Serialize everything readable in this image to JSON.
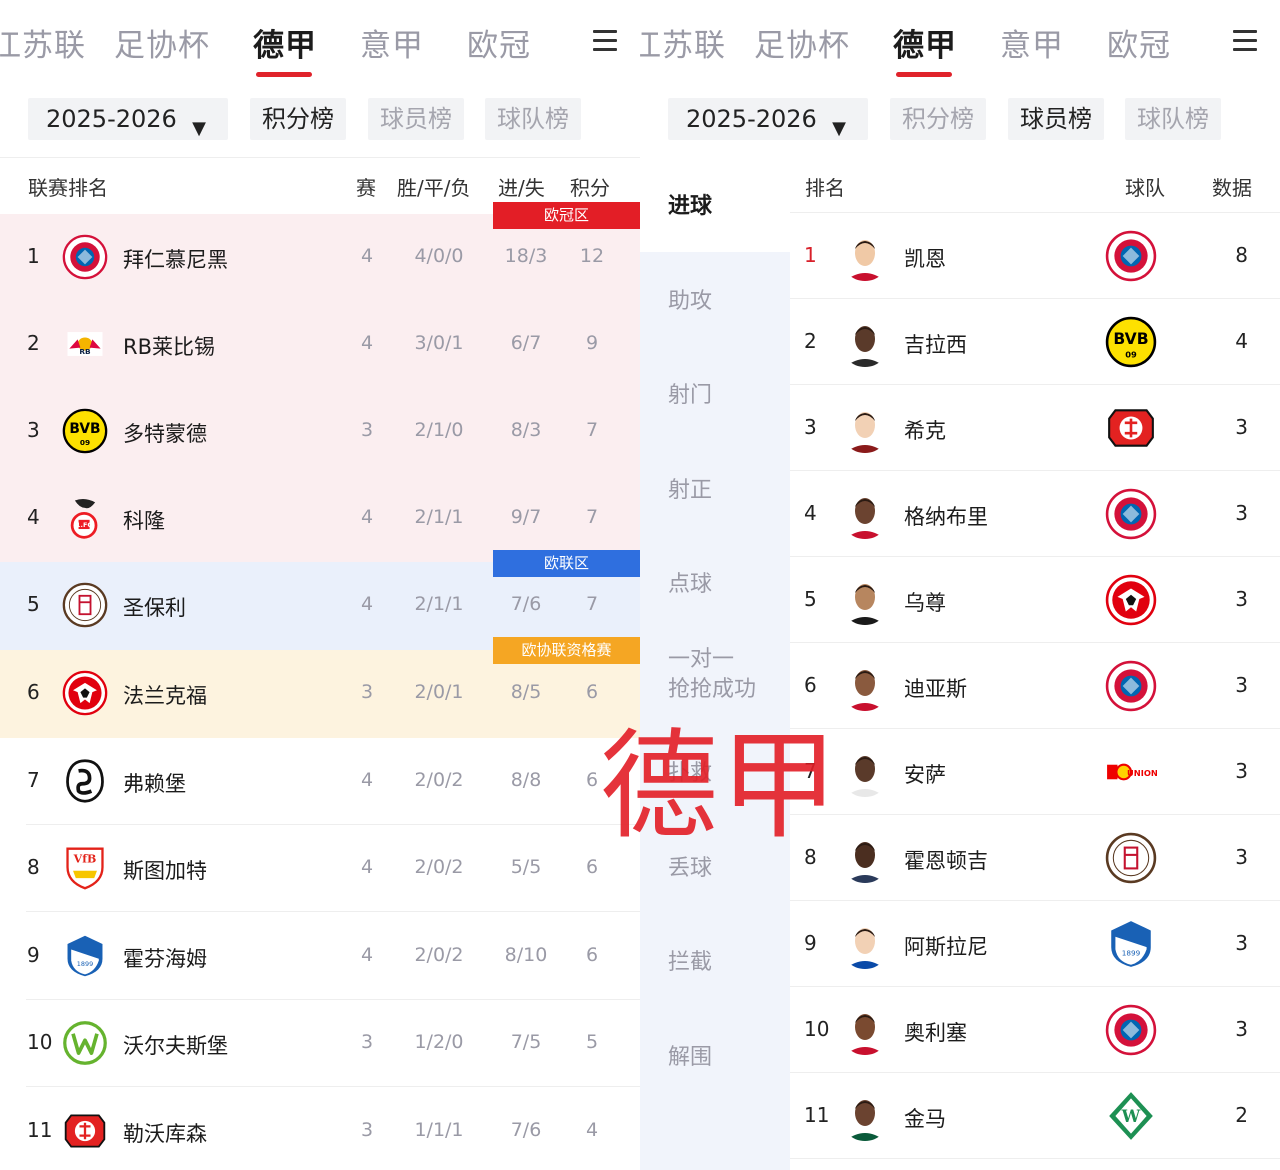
{
  "tabs": [
    "江苏联",
    "足协杯",
    "德甲",
    "意甲",
    "欧冠"
  ],
  "season": "2025-2026",
  "subtabs": [
    "积分榜",
    "球员榜",
    "球队榜"
  ],
  "standings": {
    "headers": {
      "rank": "联赛排名",
      "played": "赛",
      "wdl": "胜/平/负",
      "gf_ga": "进/失",
      "points": "积分"
    },
    "zones": [
      {
        "label": "欧冠区",
        "color": "#e31e26"
      },
      {
        "label": "欧联区",
        "color": "#2f6fdf"
      },
      {
        "label": "欧协联资格赛",
        "color": "#f5a623"
      }
    ],
    "rows": [
      {
        "rank": "1",
        "team": "拜仁慕尼黑",
        "played": "4",
        "wdl": "4/0/0",
        "gf_ga": "18/3",
        "points": "12",
        "logo": "bayern-logo"
      },
      {
        "rank": "2",
        "team": "RB莱比锡",
        "played": "4",
        "wdl": "3/0/1",
        "gf_ga": "6/7",
        "points": "9",
        "logo": "leipzig-logo"
      },
      {
        "rank": "3",
        "team": "多特蒙德",
        "played": "3",
        "wdl": "2/1/0",
        "gf_ga": "8/3",
        "points": "7",
        "logo": "dortmund-logo"
      },
      {
        "rank": "4",
        "team": "科隆",
        "played": "4",
        "wdl": "2/1/1",
        "gf_ga": "9/7",
        "points": "7",
        "logo": "koln-logo"
      },
      {
        "rank": "5",
        "team": "圣保利",
        "played": "4",
        "wdl": "2/1/1",
        "gf_ga": "7/6",
        "points": "7",
        "logo": "stpauli-logo"
      },
      {
        "rank": "6",
        "team": "法兰克福",
        "played": "3",
        "wdl": "2/0/1",
        "gf_ga": "8/5",
        "points": "6",
        "logo": "frankfurt-logo"
      },
      {
        "rank": "7",
        "team": "弗赖堡",
        "played": "4",
        "wdl": "2/0/2",
        "gf_ga": "8/8",
        "points": "6",
        "logo": "freiburg-logo"
      },
      {
        "rank": "8",
        "team": "斯图加特",
        "played": "4",
        "wdl": "2/0/2",
        "gf_ga": "5/5",
        "points": "6",
        "logo": "stuttgart-logo"
      },
      {
        "rank": "9",
        "team": "霍芬海姆",
        "played": "4",
        "wdl": "2/0/2",
        "gf_ga": "8/10",
        "points": "6",
        "logo": "hoffenheim-logo"
      },
      {
        "rank": "10",
        "team": "沃尔夫斯堡",
        "played": "3",
        "wdl": "1/2/0",
        "gf_ga": "7/5",
        "points": "5",
        "logo": "wolfsburg-logo"
      },
      {
        "rank": "11",
        "team": "勒沃库森",
        "played": "3",
        "wdl": "1/1/1",
        "gf_ga": "7/6",
        "points": "4",
        "logo": "leverkusen-logo"
      }
    ]
  },
  "players": {
    "categories": [
      "进球",
      "助攻",
      "射门",
      "射正",
      "点球",
      "一对一\n抢抢成功",
      "扑救",
      "丢球",
      "拦截",
      "解围"
    ],
    "headers": {
      "rank": "排名",
      "team": "球队",
      "value": "数据"
    },
    "rows": [
      {
        "rank": "1",
        "name": "凯恩",
        "team_logo": "bayern-logo",
        "value": "8"
      },
      {
        "rank": "2",
        "name": "吉拉西",
        "team_logo": "dortmund-logo",
        "value": "4"
      },
      {
        "rank": "3",
        "name": "希克",
        "team_logo": "leverkusen-logo",
        "value": "3"
      },
      {
        "rank": "4",
        "name": "格纳布里",
        "team_logo": "bayern-logo",
        "value": "3"
      },
      {
        "rank": "5",
        "name": "乌尊",
        "team_logo": "frankfurt-logo",
        "value": "3"
      },
      {
        "rank": "6",
        "name": "迪亚斯",
        "team_logo": "bayern-logo",
        "value": "3"
      },
      {
        "rank": "7",
        "name": "安萨",
        "team_logo": "union-logo",
        "value": "3"
      },
      {
        "rank": "8",
        "name": "霍恩顿吉",
        "team_logo": "stpauli-logo",
        "value": "3"
      },
      {
        "rank": "9",
        "name": "阿斯拉尼",
        "team_logo": "hoffenheim-logo",
        "value": "3"
      },
      {
        "rank": "10",
        "name": "奥利塞",
        "team_logo": "bayern-logo",
        "value": "3"
      },
      {
        "rank": "11",
        "name": "金马",
        "team_logo": "bremen-logo",
        "value": "2"
      }
    ]
  },
  "watermark": "德甲",
  "colors": {
    "accent": "#e0232b",
    "ucl": "#fbeef0",
    "uel": "#eaf0fb",
    "uecl": "#fdf3df",
    "sidebar": "#f1f4fb"
  }
}
